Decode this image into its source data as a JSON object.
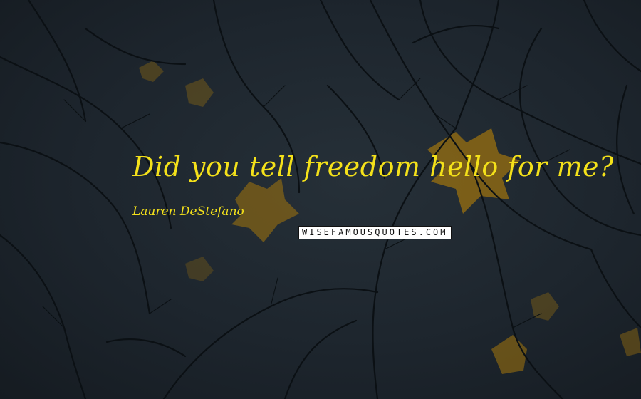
{
  "quote": {
    "text": "Did you tell freedom hello for me?"
  },
  "author": {
    "name": "Lauren DeStefano"
  },
  "watermark": {
    "text": "WISEFAMOUSQUOTES.COM"
  },
  "colors": {
    "quote_text": "#f4e11a",
    "background": "#1d252d",
    "branches": "#0e1317",
    "leaves": "#b8860b"
  }
}
